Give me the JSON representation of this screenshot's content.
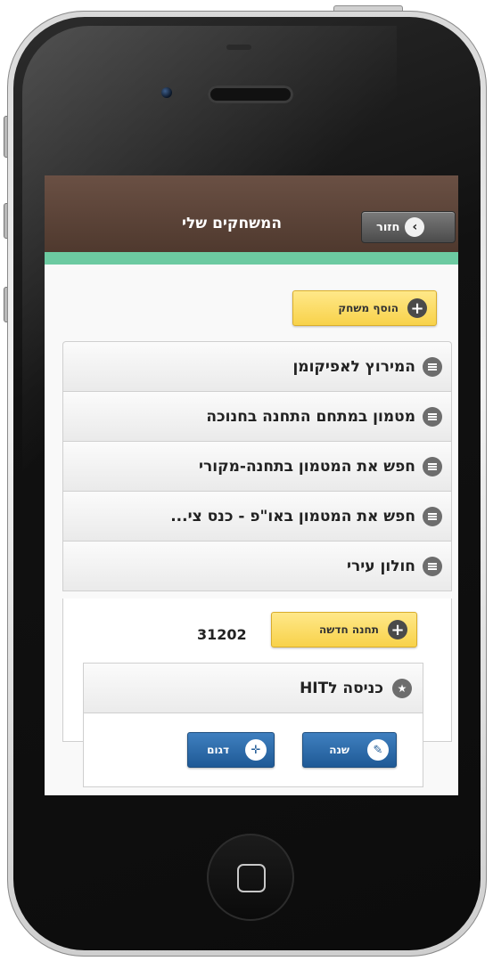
{
  "header": {
    "title": "המשחקים שלי",
    "back_label": "חזור",
    "back_icon": "chevron-right-icon"
  },
  "add_game_button": {
    "label": "הוסף משחק",
    "icon": "plus-circle-icon"
  },
  "games": [
    {
      "label": "המירוץ לאפיקומן"
    },
    {
      "label": "מטמון במתחם התחנה בחנוכה"
    },
    {
      "label": "חפש את המטמון בתחנה-מקורי"
    },
    {
      "label": "חפש את המטמון באו\"פ - כנס צי..."
    },
    {
      "label": "חולון עירי"
    }
  ],
  "expanded_game": {
    "add_station_label": "תחנה חדשה",
    "game_code": "31202",
    "station": {
      "label": "כניסה לHIT",
      "edit_label": "שנה",
      "sample_label": "דגום"
    }
  },
  "colors": {
    "header_bg": "#5c4438",
    "accent_strip": "#6ccaa1",
    "yellow_button": "#f8d24a",
    "blue_button": "#1f5a96"
  }
}
